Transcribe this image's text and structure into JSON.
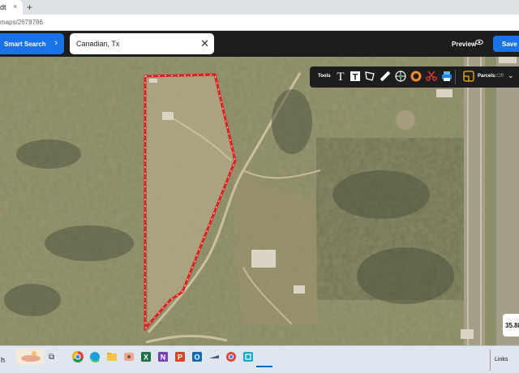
{
  "browser": {
    "tab_title": "dt",
    "tab_close": "×",
    "new_tab": "+",
    "url": "maps/2678786"
  },
  "header": {
    "smart_search_label": "Smart Search",
    "smart_search_chevron": "›",
    "search_value": "Canadian, Tx",
    "search_clear": "✕",
    "preview_label": "Preview",
    "save_label": "Save"
  },
  "toolbar": {
    "tools_label": "Tools",
    "parcels_label": "Parcels:",
    "parcels_value": "Off",
    "icons": [
      "text-icon",
      "text-box-icon",
      "polygon-icon",
      "ruler-icon",
      "globe-icon",
      "donut-icon",
      "scissors-icon",
      "print-icon",
      "parcels-icon"
    ]
  },
  "map": {
    "coordinate_readout": "35.88",
    "parcel_outline_color": "#e02020"
  },
  "taskbar": {
    "search_fragment": "h",
    "links_label": "Links",
    "apps": [
      "chrome-icon",
      "edge-icon",
      "file-explorer-icon",
      "photos-icon",
      "excel-icon",
      "onenote-icon",
      "powerpoint-icon",
      "outlook-icon",
      "app-icon",
      "chrome-icon",
      "screen-snip-icon"
    ]
  }
}
